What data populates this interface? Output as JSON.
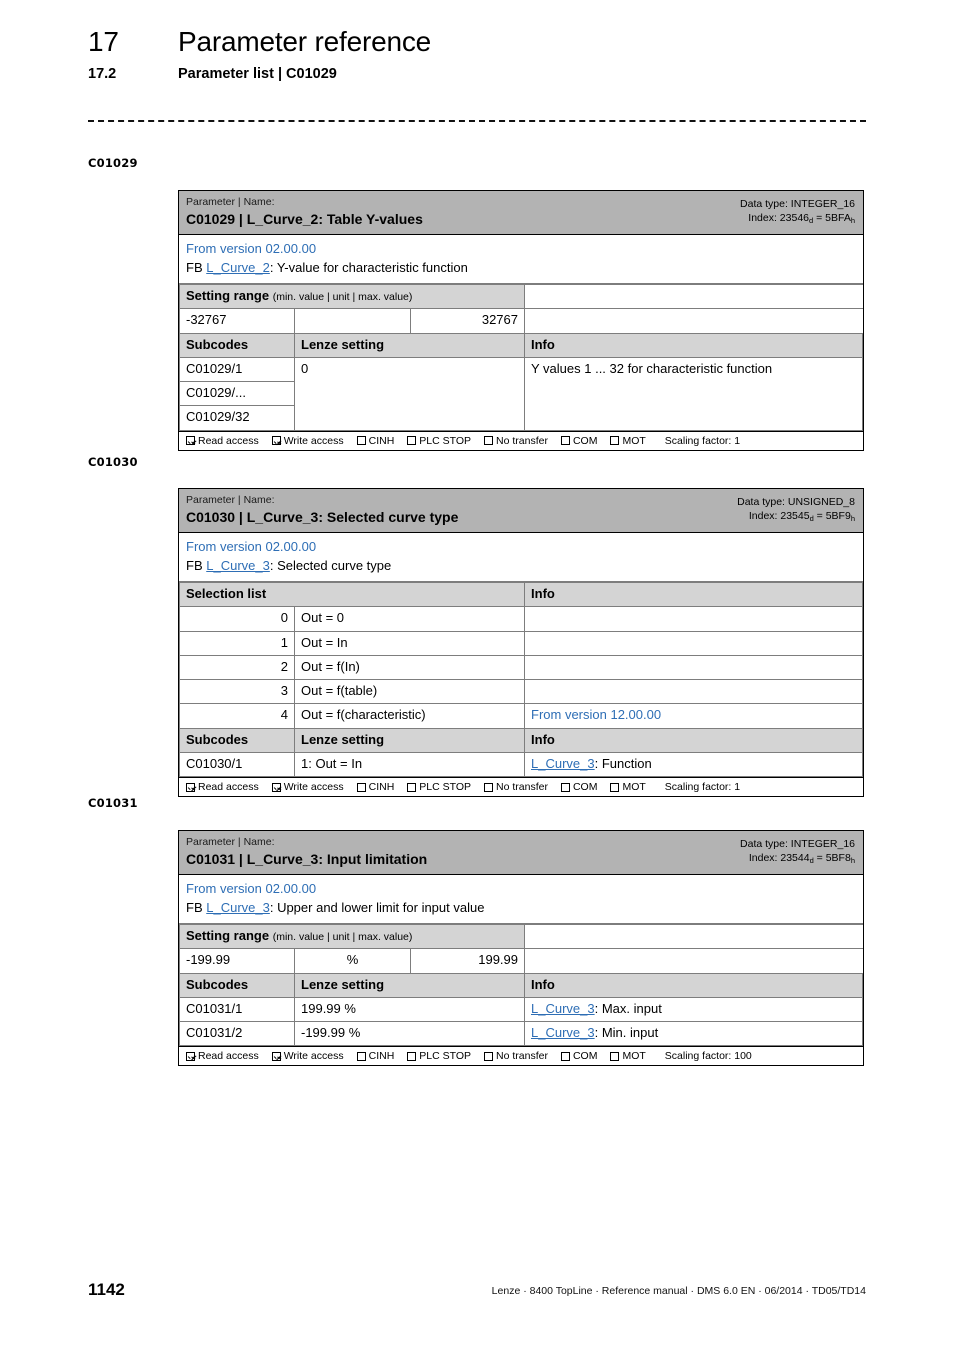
{
  "header": {
    "chapter_number": "17",
    "chapter_title": "Parameter reference",
    "section_number": "17.2",
    "section_title": "Parameter list | C01029"
  },
  "margin_labels": {
    "block1": "C01029",
    "block2": "C01030",
    "block3": "C01031"
  },
  "common": {
    "param_name_kicker": "Parameter | Name:",
    "setting_range_head": "Setting range",
    "setting_range_note": "(min. value | unit | max. value)",
    "subcodes_head": "Subcodes",
    "lenze_setting_head": "Lenze setting",
    "info_head": "Info",
    "selection_list_head": "Selection list",
    "fb_prefix": "FB ",
    "access": {
      "read": "Read access",
      "write": "Write access",
      "cinh": "CINH",
      "plc_stop": "PLC STOP",
      "no_transfer": "No transfer",
      "com": "COM",
      "mot": "MOT"
    }
  },
  "blocks": [
    {
      "id": "C01029",
      "title": "C01029 | L_Curve_2: Table Y-values",
      "data_type": "Data type: INTEGER_16",
      "index_prefix": "Index: 23546",
      "index_sub_d": "d",
      "index_mid": " = 5BFA",
      "index_sub_h": "h",
      "version": "From version 02.00.00",
      "fb_link": "L_Curve_2",
      "fb_desc": ": Y-value for characteristic function",
      "setting_range": {
        "min": "-32767",
        "unit": "",
        "max": "32767"
      },
      "subcodes": [
        {
          "code": "C01029/1",
          "setting": "0",
          "info": "Y values 1 ... 32 for characteristic function",
          "info_link": ""
        },
        {
          "code": "C01029/...",
          "setting": "",
          "info": "",
          "info_link": ""
        },
        {
          "code": "C01029/32",
          "setting": "",
          "info": "",
          "info_link": ""
        }
      ],
      "scaling_factor": "Scaling factor: 1"
    },
    {
      "id": "C01030",
      "title": "C01030 | L_Curve_3: Selected curve type",
      "data_type": "Data type: UNSIGNED_8",
      "index_prefix": "Index: 23545",
      "index_sub_d": "d",
      "index_mid": " = 5BF9",
      "index_sub_h": "h",
      "version": "From version 02.00.00",
      "fb_link": "L_Curve_3",
      "fb_desc": ": Selected curve type",
      "selection_list": [
        {
          "value": "0",
          "label": "Out = 0",
          "info": ""
        },
        {
          "value": "1",
          "label": "Out = In",
          "info": ""
        },
        {
          "value": "2",
          "label": "Out = f(In)",
          "info": ""
        },
        {
          "value": "3",
          "label": "Out = f(table)",
          "info": ""
        },
        {
          "value": "4",
          "label": "Out = f(characteristic)",
          "info": "From version 12.00.00"
        }
      ],
      "subcodes": [
        {
          "code": "C01030/1",
          "setting": "1: Out = In",
          "info_link": "L_Curve_3",
          "info": ": Function"
        }
      ],
      "scaling_factor": "Scaling factor: 1"
    },
    {
      "id": "C01031",
      "title": "C01031 | L_Curve_3: Input limitation",
      "data_type": "Data type: INTEGER_16",
      "index_prefix": "Index: 23544",
      "index_sub_d": "d",
      "index_mid": " = 5BF8",
      "index_sub_h": "h",
      "version": "From version 02.00.00",
      "fb_link": "L_Curve_3",
      "fb_desc": ": Upper and lower limit for input value",
      "setting_range": {
        "min": "-199.99",
        "unit": "%",
        "max": "199.99"
      },
      "subcodes": [
        {
          "code": "C01031/1",
          "setting": "199.99 %",
          "info_link": "L_Curve_3",
          "info": ": Max. input"
        },
        {
          "code": "C01031/2",
          "setting": "-199.99 %",
          "info_link": "L_Curve_3",
          "info": ": Min. input"
        }
      ],
      "scaling_factor": "Scaling factor: 100"
    }
  ],
  "footer": {
    "page_number": "1142",
    "reference": "Lenze · 8400 TopLine · Reference manual · DMS 6.0 EN · 06/2014 · TD05/TD14"
  },
  "colors": {
    "link_blue": "#2e6eb5",
    "header_band": "#b3b3b3",
    "column_head": "#d4d4d4"
  }
}
